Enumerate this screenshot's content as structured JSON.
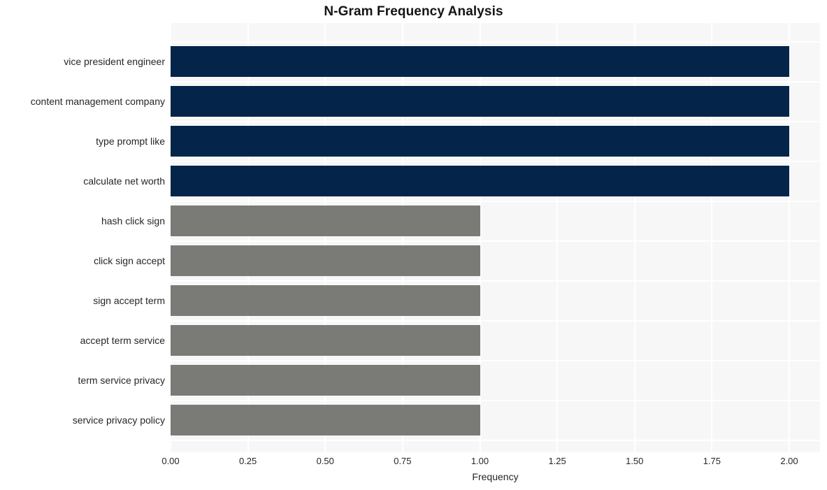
{
  "chart_data": {
    "type": "bar",
    "orientation": "horizontal",
    "title": "N-Gram Frequency Analysis",
    "xlabel": "Frequency",
    "ylabel": "",
    "xlim": [
      0.0,
      2.0
    ],
    "grid": true,
    "legend": "none",
    "xticks": [
      "0.00",
      "0.25",
      "0.50",
      "0.75",
      "1.00",
      "1.25",
      "1.50",
      "1.75",
      "2.00"
    ],
    "xtick_values": [
      0.0,
      0.25,
      0.5,
      0.75,
      1.0,
      1.25,
      1.5,
      1.75,
      2.0
    ],
    "categories": [
      "vice president engineer",
      "content management company",
      "type prompt like",
      "calculate net worth",
      "hash click sign",
      "click sign accept",
      "sign accept term",
      "accept term service",
      "term service privacy",
      "service privacy policy"
    ],
    "values": [
      2,
      2,
      2,
      2,
      1,
      1,
      1,
      1,
      1,
      1
    ],
    "bar_colors": [
      "#052449",
      "#052449",
      "#052449",
      "#052449",
      "#7a7a77",
      "#7a7a77",
      "#7a7a77",
      "#7a7a77",
      "#7a7a77",
      "#7a7a77"
    ],
    "colors": {
      "high": "#052449",
      "low": "#7a7a77",
      "plot_background": "#f7f7f7",
      "page_background": "#ffffff",
      "gridline": "#ffffff",
      "text": "#262626",
      "title_text": "#141414"
    }
  }
}
